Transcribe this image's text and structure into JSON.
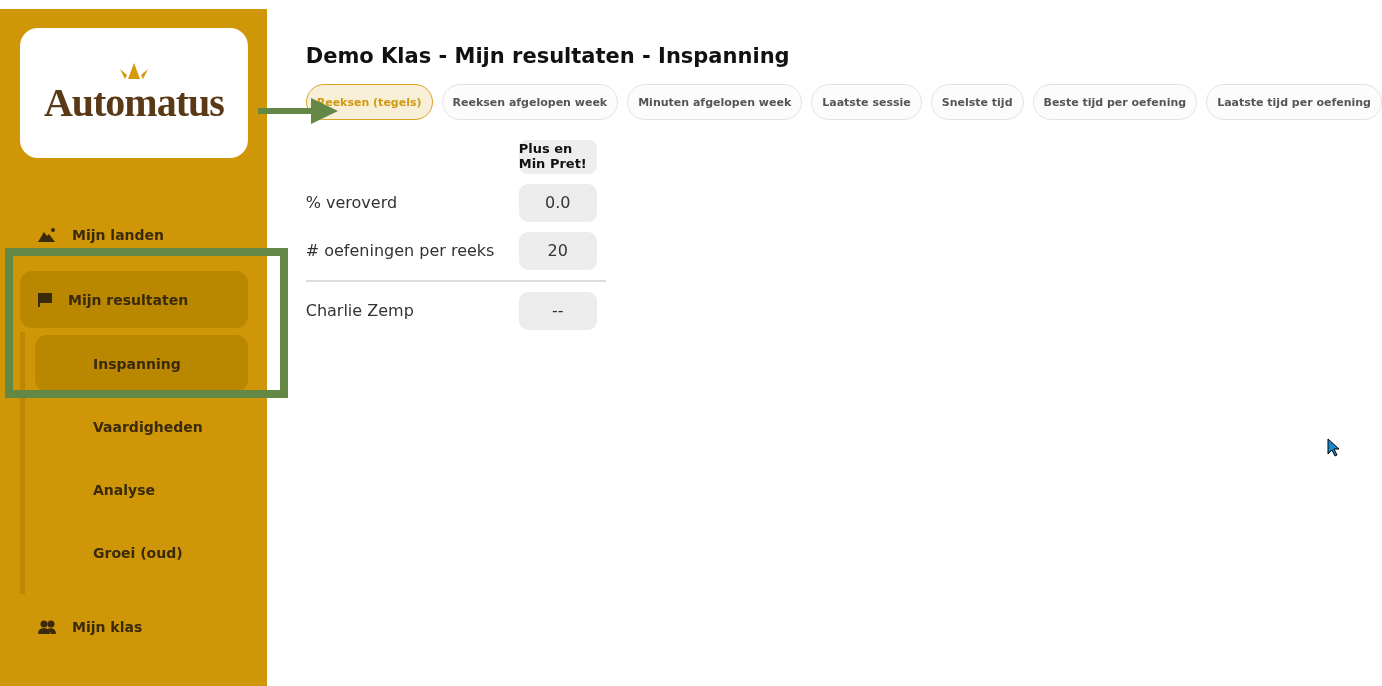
{
  "logo": {
    "text": "Automatus"
  },
  "nav": [
    {
      "label": "Mijn landen",
      "kind": "worlds",
      "selected": false
    },
    {
      "label": "Mijn resultaten",
      "kind": "results",
      "selected": true,
      "children": [
        {
          "label": "Inspanning",
          "selected": true
        },
        {
          "label": "Vaardigheden",
          "selected": false
        },
        {
          "label": "Analyse",
          "selected": false
        },
        {
          "label": "Groei (oud)",
          "selected": false
        }
      ]
    },
    {
      "label": "Mijn klas",
      "kind": "class",
      "selected": false
    }
  ],
  "title": "Demo Klas - Mijn resultaten - Inspanning",
  "tabs": [
    {
      "label": "Reeksen (tegels)",
      "selected": true
    },
    {
      "label": "Reeksen afgelopen week",
      "selected": false
    },
    {
      "label": "Minuten afgelopen week",
      "selected": false
    },
    {
      "label": "Laatste sessie",
      "selected": false
    },
    {
      "label": "Snelste tijd",
      "selected": false
    },
    {
      "label": "Beste tijd per oefening",
      "selected": false
    },
    {
      "label": "Laatste tijd per oefening",
      "selected": false
    }
  ],
  "table": {
    "columns": [
      "Plus en Min Pret!"
    ],
    "rows": [
      {
        "kind": "summary",
        "label": "% veroverd",
        "values": [
          "0.0"
        ]
      },
      {
        "kind": "summary",
        "label": "# oefeningen per reeks",
        "values": [
          "20"
        ]
      },
      {
        "kind": "student",
        "label": "Charlie Zemp",
        "values": [
          "--"
        ]
      }
    ]
  }
}
